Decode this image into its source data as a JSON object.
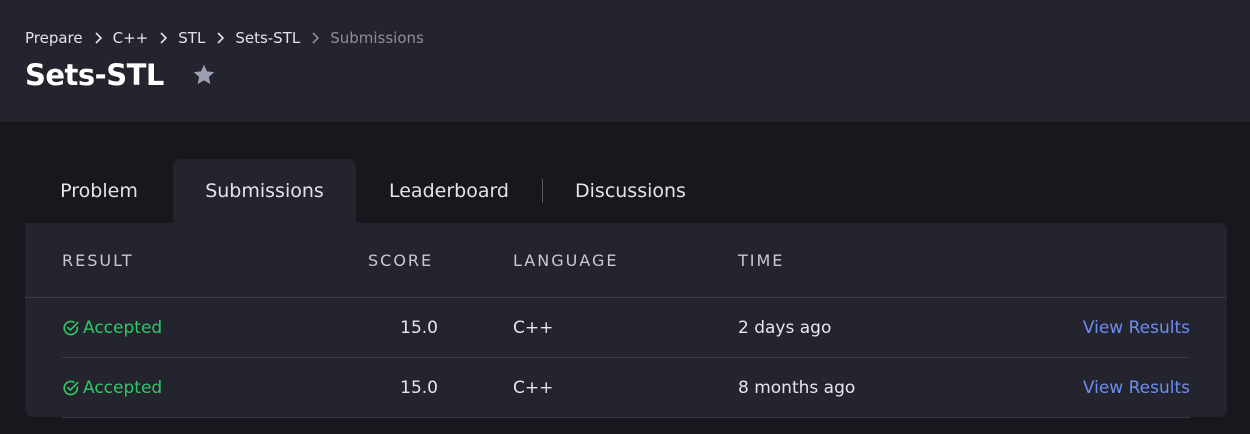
{
  "breadcrumb": {
    "items": [
      "Prepare",
      "C++",
      "STL",
      "Sets-STL"
    ],
    "current": "Submissions"
  },
  "page": {
    "title": "Sets-STL"
  },
  "tabs": [
    {
      "label": "Problem"
    },
    {
      "label": "Submissions",
      "active": true
    },
    {
      "label": "Leaderboard"
    },
    {
      "label": "Discussions"
    }
  ],
  "table": {
    "headers": {
      "result": "RESULT",
      "score": "SCORE",
      "language": "LANGUAGE",
      "time": "TIME"
    },
    "rows": [
      {
        "result": "Accepted",
        "score": "15.0",
        "language": "C++",
        "time": "2 days ago",
        "action": "View Results"
      },
      {
        "result": "Accepted",
        "score": "15.0",
        "language": "C++",
        "time": "8 months ago",
        "action": "View Results"
      }
    ]
  },
  "colors": {
    "accepted": "#2ec866",
    "link": "#6d8df2",
    "header_bg": "#24242e",
    "page_bg": "#17171d"
  },
  "icons": {
    "breadcrumb_separator": "chevron-right-icon",
    "bookmark": "star-icon",
    "result_status": "check-circle-icon"
  }
}
